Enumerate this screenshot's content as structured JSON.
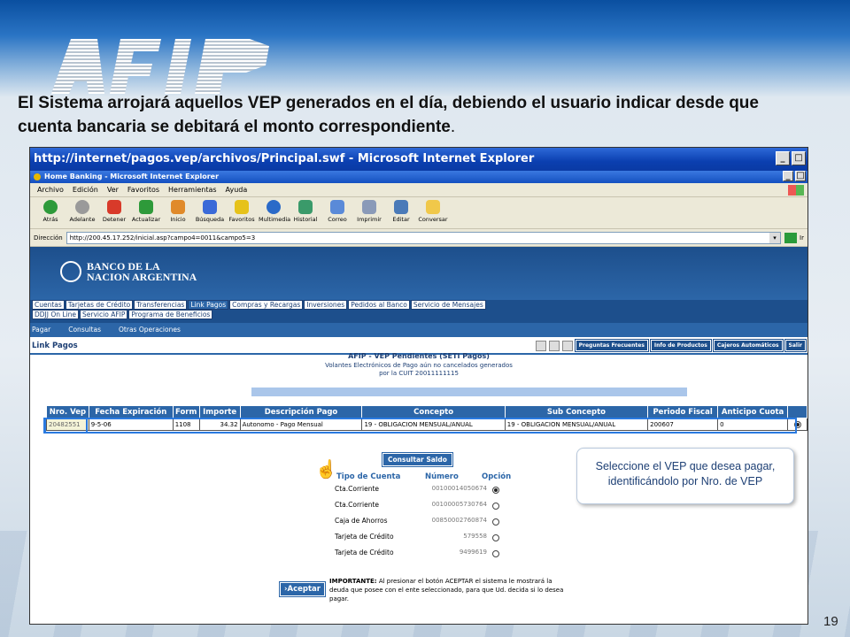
{
  "slide": {
    "logo_text": "AFIP",
    "headline_part1": "El Sistema arrojará aquellos VEP generados en el día, debiendo el usuario indicar desde que cuenta bancaria se debitará el monto correspondiente",
    "headline_period": ".",
    "page_number": "19"
  },
  "outer_window": {
    "title": "http://internet/pagos.vep/archivos/Principal.swf - Microsoft Internet Explorer",
    "buttons": [
      "_",
      "□"
    ]
  },
  "inner_window": {
    "title": "Home Banking - Microsoft Internet Explorer",
    "buttons": [
      "_",
      "□"
    ]
  },
  "menubar": [
    "Archivo",
    "Edición",
    "Ver",
    "Favoritos",
    "Herramientas",
    "Ayuda"
  ],
  "toolbar": [
    {
      "label": "Atrás",
      "icon": "back-icon",
      "color": "#2e9a3a"
    },
    {
      "label": "Adelante",
      "icon": "forward-icon",
      "color": "#9a9a9a"
    },
    {
      "label": "Detener",
      "icon": "stop-icon",
      "color": "#d83a2a"
    },
    {
      "label": "Actualizar",
      "icon": "refresh-icon",
      "color": "#2e9a3a"
    },
    {
      "label": "Inicio",
      "icon": "home-icon",
      "color": "#e08a2a"
    },
    {
      "label": "Búsqueda",
      "icon": "search-icon",
      "color": "#3a6ad8"
    },
    {
      "label": "Favoritos",
      "icon": "favorites-icon",
      "color": "#e6c21a"
    },
    {
      "label": "Multimedia",
      "icon": "multimedia-icon",
      "color": "#2a6ac8"
    },
    {
      "label": "Historial",
      "icon": "history-icon",
      "color": "#3a9a6a"
    },
    {
      "label": "Correo",
      "icon": "mail-icon",
      "color": "#5a8ad8"
    },
    {
      "label": "Imprimir",
      "icon": "print-icon",
      "color": "#8a9ab8"
    },
    {
      "label": "Editar",
      "icon": "edit-icon",
      "color": "#4a7ab8"
    },
    {
      "label": "Conversar",
      "icon": "messenger-icon",
      "color": "#f0c84a"
    }
  ],
  "address_bar": {
    "label": "Dirección",
    "url": "http://200.45.17.252/inicial.asp?campo4=0011&campo5=3",
    "go_label": "Ir"
  },
  "bank": {
    "name_line1": "BANCO DE LA",
    "name_line2": "NACION ARGENTINA",
    "tabs_row1": [
      "Cuentas",
      "Tarjetas de Crédito",
      "Transferencias",
      "Link Pagos",
      "Compras y Recargas",
      "Inversiones",
      "Pedidos al Banco",
      "Servicio de Mensajes"
    ],
    "tabs_row2": [
      "DDJJ On Line",
      "Servicio AFIP",
      "Programa de Beneficios"
    ],
    "subnav": [
      "Pagar",
      "Consultas",
      "Otras Operaciones"
    ],
    "section_title": "Link Pagos",
    "section_buttons": [
      "Preguntas Frecuentes",
      "Info de Productos",
      "Cajeros Automáticos",
      "Salir"
    ]
  },
  "vep": {
    "title": "AFIP - VEP Pendientes (SETI Pagos)",
    "subtitle1": "Volantes Electrónicos de Pago aún no cancelados generados",
    "subtitle2": "por la CUIT 20011111115",
    "headers": [
      "Nro. Vep",
      "Fecha Expiración",
      "Form",
      "Importe",
      "Descripción Pago",
      "Concepto",
      "Sub Concepto",
      "Periodo Fiscal",
      "Anticipo Cuota",
      ""
    ],
    "row": [
      "20482551",
      "9-5-06",
      "1108",
      "34.32",
      "Autonomo - Pago Mensual",
      "19 - OBLIGACION MENSUAL/ANUAL",
      "19 - OBLIGACION MENSUAL/ANUAL",
      "200607",
      "0",
      ""
    ],
    "row_selected": true
  },
  "accounts": {
    "consultar_label": "Consultar Saldo",
    "head_tipo": "Tipo de Cuenta",
    "head_numero": "Número",
    "head_opcion": "Opción",
    "rows": [
      {
        "type": "Cta.Corriente",
        "number": "00100014050674",
        "selected": true
      },
      {
        "type": "Cta.Corriente",
        "number": "00100005730764",
        "selected": false
      },
      {
        "type": "Caja de Ahorros",
        "number": "00850002760874",
        "selected": false
      },
      {
        "type": "Tarjeta de Crédito",
        "number": "579558",
        "selected": false
      },
      {
        "type": "Tarjeta de Crédito",
        "number": "9499619",
        "selected": false
      }
    ]
  },
  "callout": {
    "line1": "Seleccione el VEP que desea pagar,",
    "line2": "identificándolo por Nro. de VEP"
  },
  "aceptar_label": "Aceptar",
  "importante": {
    "label": "IMPORTANTE:",
    "text": "Al presionar el botón ACEPTAR el sistema le mostrará la deuda que posee con el ente seleccionado, para que Ud. decida si lo desea pagar."
  }
}
